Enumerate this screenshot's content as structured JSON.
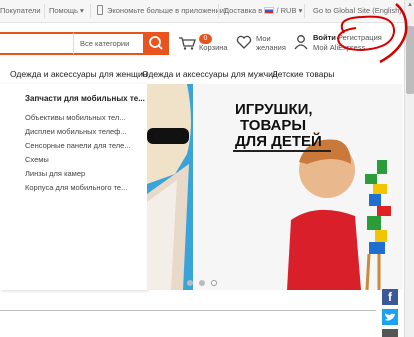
{
  "topbar": {
    "buyers": "Покупатели",
    "help": "Помощь",
    "app_promo": "Экономьте больше в приложении!",
    "delivery": "Доставка в",
    "currency": "/ RUB",
    "global_site": "Go to Global Site (English)"
  },
  "header": {
    "search_placeholder": "",
    "category": "Все категории",
    "cart_label": "Корзина",
    "cart_count": "0",
    "wishlist_line1": "Мои",
    "wishlist_line2": "желания",
    "login": "Войти",
    "register": "Регистрация",
    "my_ali": "Мой AliExpress"
  },
  "nav": {
    "women": "Одежда и аксессуары для женщин",
    "men": "Одежда и аксессуары для мужчин",
    "kids": "Детские товары"
  },
  "menu": {
    "heading": "Запчасти для мобильных те...",
    "items": [
      "Объективы мобильных тел...",
      "Дисплеи мобильных телеф...",
      "Сенсорные панели для теле...",
      "Схемы",
      "Линзы для камер",
      "Корпуса для мобильного те..."
    ]
  },
  "banner": {
    "line1": "ИГРУШКИ,",
    "line2": "ТОВАРЫ",
    "line3": "ДЛЯ ДЕТЕЙ",
    "slide_count": 3,
    "active_slide": 3
  },
  "colors": {
    "accent": "#e9541e",
    "annotation": "#d40000",
    "facebook": "#3b5998",
    "twitter": "#1da1f2"
  },
  "icons": [
    "phone-icon",
    "search-icon",
    "cart-icon",
    "heart-icon",
    "user-icon",
    "facebook-icon",
    "twitter-icon"
  ]
}
